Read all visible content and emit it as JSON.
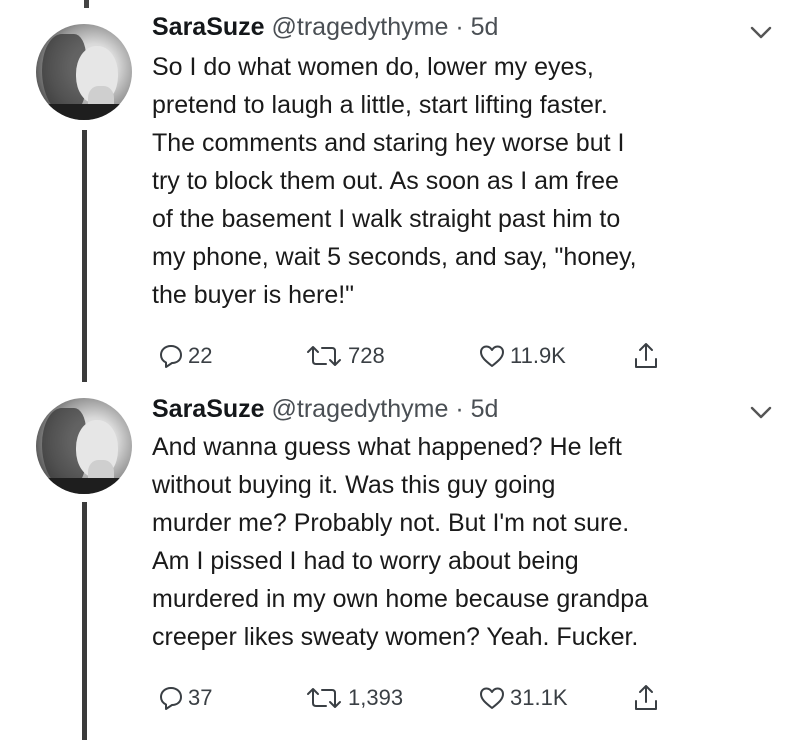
{
  "tweets": [
    {
      "name": "SaraSuze",
      "handle": "@tragedythyme",
      "separator": "·",
      "time": "5d",
      "lines": [
        "So I do what women do, lower my eyes,",
        "pretend to laugh a little, start lifting faster.",
        "The comments and staring hey worse but I",
        "try to block them out. As soon as I am free",
        "of the basement I walk straight past him to",
        "my phone, wait 5 seconds, and say, \"honey,",
        "the buyer is here!\""
      ],
      "replies": "22",
      "retweets": "728",
      "likes": "11.9K"
    },
    {
      "name": "SaraSuze",
      "handle": "@tragedythyme",
      "separator": "·",
      "time": "5d",
      "lines": [
        "And wanna guess what happened? He left",
        "without buying it. Was this guy going",
        "murder me? Probably not. But I'm not sure.",
        "Am I pissed I had to worry about being",
        "murdered in my own home because grandpa",
        "creeper likes sweaty women? Yeah. Fucker."
      ],
      "replies": "37",
      "retweets": "1,393",
      "likes": "31.1K"
    }
  ],
  "icons": {
    "reply": "reply-icon",
    "retweet": "retweet-icon",
    "like": "heart-icon",
    "share": "share-icon",
    "menu": "chevron-down-icon"
  }
}
